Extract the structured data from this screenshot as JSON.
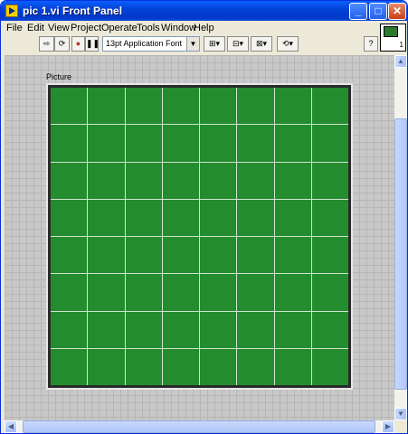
{
  "window": {
    "title": "pic 1.vi Front Panel"
  },
  "menu": [
    "File",
    "Edit",
    "View",
    "Project",
    "Operate",
    "Tools",
    "Window",
    "Help"
  ],
  "toolbar": {
    "font": "13pt Application Font"
  },
  "vi_icon": {
    "number": "1"
  },
  "panel": {
    "picture_label": "Picture",
    "grid": {
      "rows": 8,
      "cols": 8,
      "color": "#238c2e"
    }
  },
  "colors": {
    "titlebar": "#0443d8",
    "grid_cell": "#238c2e",
    "panel_bg": "#c8c8c8"
  }
}
